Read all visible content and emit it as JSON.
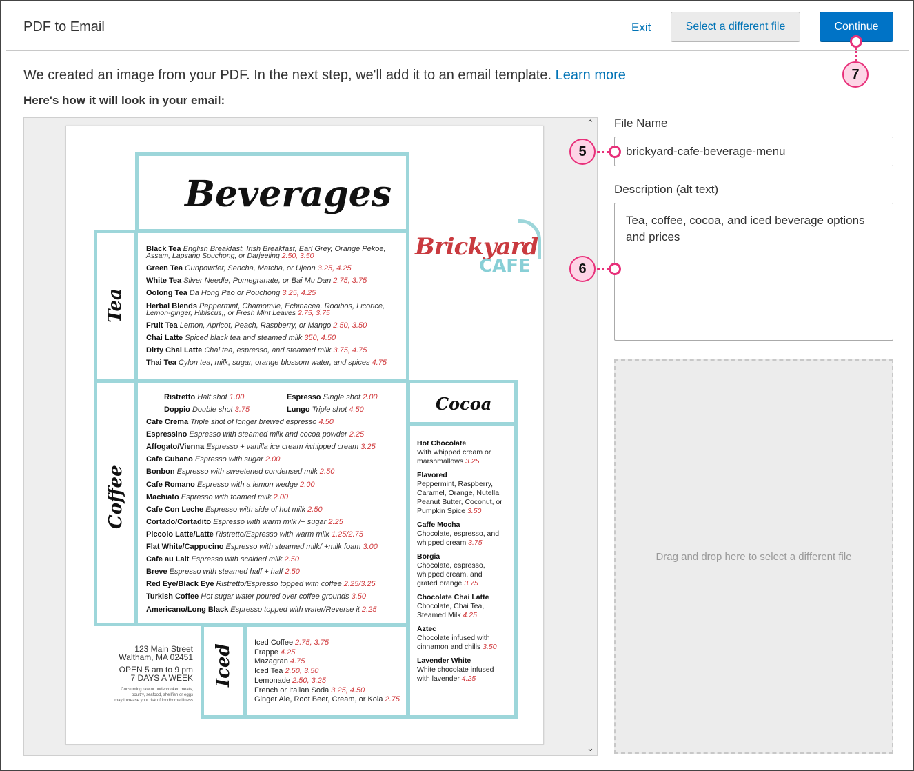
{
  "app_title": "PDF to Email",
  "header": {
    "exit_label": "Exit",
    "select_file_label": "Select a different file",
    "continue_label": "Continue"
  },
  "intro_text": "We created an image from your PDF. In the next step, we'll add it to an email template.",
  "learn_more": "Learn more",
  "preview_heading": "Here's how it will look in your email:",
  "file_name": {
    "label": "File Name",
    "value": "brickyard-cafe-beverage-menu"
  },
  "description": {
    "label": "Description (alt text)",
    "value": "Tea, coffee, cocoa, and iced beverage options and prices"
  },
  "drop_zone": "Drag and drop here to select a different file",
  "callouts": {
    "c5": "5",
    "c6": "6",
    "c7": "7"
  },
  "colors": {
    "accent_blue": "#0073c6",
    "callout_pink": "#e8307a",
    "menu_teal": "#9dd6da",
    "price_red": "#d0393c"
  },
  "menu": {
    "title": "Beverages",
    "logo_top": "Brickyard",
    "logo_bottom": "CAFE",
    "sections": {
      "tea": "Tea",
      "coffee": "Coffee",
      "cocoa": "Cocoa",
      "iced": "Iced"
    },
    "tea": [
      {
        "name": "Black Tea",
        "desc": "English Breakfast, Irish Breakfast, Earl Grey, Orange Pekoe,",
        "desc2": "Assam, Lapsang Souchong, or Darjeeling",
        "price": "2.50, 3.50"
      },
      {
        "name": "Green Tea",
        "desc": "Gunpowder, Sencha, Matcha, or Ujeon",
        "price": "3.25, 4.25"
      },
      {
        "name": "White Tea",
        "desc": "Silver Needle, Pomegranate, or Bai Mu Dan",
        "price": "2.75, 3.75"
      },
      {
        "name": "Oolong Tea",
        "desc": "Da Hong Pao or Pouchong",
        "price": "3.25, 4.25"
      },
      {
        "name": "Herbal Blends",
        "desc": "Peppermint, Chamomile, Echinacea, Rooibos, Licorice,",
        "desc2": "Lemon-ginger, Hibiscus,, or Fresh Mint Leaves",
        "price": "2.75, 3.75"
      },
      {
        "name": "Fruit Tea",
        "desc": "Lemon, Apricot, Peach, Raspberry, or Mango",
        "price": "2.50, 3.50"
      },
      {
        "name": "Chai Latte",
        "desc": "Spiced black tea and steamed milk",
        "price": "350, 4.50"
      },
      {
        "name": "Dirty Chai Latte",
        "desc": "Chai tea, espresso, and steamed milk",
        "price": "3.75, 4.75"
      },
      {
        "name": "Thai Tea",
        "desc": "Cylon tea, milk, sugar, orange blossom water, and spices",
        "price": "4.75"
      }
    ],
    "coffee_pairs": [
      {
        "name": "Ristretto",
        "desc": "Half shot",
        "price": "1.00"
      },
      {
        "name": "Espresso",
        "desc": "Single shot",
        "price": "2.00"
      },
      {
        "name": "Doppio",
        "desc": "Double shot",
        "price": "3.75"
      },
      {
        "name": "Lungo",
        "desc": "Triple shot",
        "price": "4.50"
      }
    ],
    "coffee": [
      {
        "name": "Cafe Crema",
        "desc": "Triple shot of longer brewed espresso",
        "price": "4.50"
      },
      {
        "name": "Espressino",
        "desc": "Espresso with steamed milk and cocoa powder",
        "price": "2.25"
      },
      {
        "name": "Affogato/Vienna",
        "desc": "Espresso + vanilla ice cream /whipped cream",
        "price": "3.25"
      },
      {
        "name": "Cafe Cubano",
        "desc": "Espresso with sugar",
        "price": "2.00"
      },
      {
        "name": "Bonbon",
        "desc": "Espresso with sweetened condensed milk",
        "price": "2.50"
      },
      {
        "name": "Cafe Romano",
        "desc": "Espresso with a lemon wedge",
        "price": "2.00"
      },
      {
        "name": "Machiato",
        "desc": "Espresso with foamed milk",
        "price": "2.00"
      },
      {
        "name": "Cafe Con Leche",
        "desc": "Espresso with side of hot milk",
        "price": "2.50"
      },
      {
        "name": "Cortado/Cortadito",
        "desc": "Espresso with warm milk /+ sugar",
        "price": "2.25"
      },
      {
        "name": "Piccolo Latte/Latte",
        "desc": "Ristretto/Espresso with warm milk",
        "price": "1.25/2.75"
      },
      {
        "name": "Flat White/Cappucino",
        "desc": "Espresso with steamed milk/ +milk foam",
        "price": "3.00"
      },
      {
        "name": "Cafe au Lait",
        "desc": "Espresso with scalded milk",
        "price": "2.50"
      },
      {
        "name": "Breve",
        "desc": "Espresso with steamed half + half",
        "price": "2.50"
      },
      {
        "name": "Red Eye/Black Eye",
        "desc": "Ristretto/Espresso topped with coffee",
        "price": "2.25/3.25"
      },
      {
        "name": "Turkish Coffee",
        "desc": "Hot sugar water poured over coffee grounds",
        "price": "3.50"
      },
      {
        "name": "Americano/Long Black",
        "desc": "Espresso topped with water/Reverse it",
        "price": "2.25"
      }
    ],
    "cocoa": [
      {
        "name": "Hot Chocolate",
        "lines": [
          "With whipped cream or",
          "marshmallows"
        ],
        "price": "3.25"
      },
      {
        "name": "Flavored",
        "lines": [
          "Peppermint, Raspberry,",
          "Caramel, Orange, Nutella,",
          "Peanut Butter, Coconut, or",
          "Pumpkin Spice"
        ],
        "price": "3.50"
      },
      {
        "name": "Caffe Mocha",
        "lines": [
          "Chocolate, espresso, and",
          "whipped cream"
        ],
        "price": "3.75"
      },
      {
        "name": "Borgia",
        "lines": [
          "Chocolate, espresso,",
          "whipped cream, and",
          "grated orange"
        ],
        "price": "3.75"
      },
      {
        "name": "Chocolate Chai Latte",
        "lines": [
          "Chocolate, Chai Tea,",
          "Steamed Milk"
        ],
        "price": "4.25"
      },
      {
        "name": "Aztec",
        "lines": [
          "Chocolate infused with",
          "cinnamon and chilis"
        ],
        "price": "3.50"
      },
      {
        "name": "Lavender White",
        "lines": [
          "White chocolate infused",
          "with lavender"
        ],
        "price": "4.25"
      }
    ],
    "iced": [
      {
        "name": "Iced Coffee",
        "price": "2.75, 3.75"
      },
      {
        "name": "Frappe",
        "price": "4.25"
      },
      {
        "name": "Mazagran",
        "price": "4.75"
      },
      {
        "name": "Iced Tea",
        "price": "2.50, 3.50"
      },
      {
        "name": "Lemonade",
        "price": "2.50, 3.25"
      },
      {
        "name": "French or Italian Soda",
        "price": "3.25, 4.50"
      },
      {
        "name": "Ginger Ale, Root Beer, Cream, or Kola",
        "price": "2.75"
      }
    ],
    "address": [
      "123 Main Street",
      "Waltham, MA 02451"
    ],
    "hours": [
      "OPEN 5 am to 9 pm",
      "7 DAYS A WEEK"
    ],
    "disclaimer": [
      "Consuming raw or undercooked meats,",
      "poultry, seafood, shellfish or eggs",
      "may increase your risk of foodborne illness"
    ]
  }
}
